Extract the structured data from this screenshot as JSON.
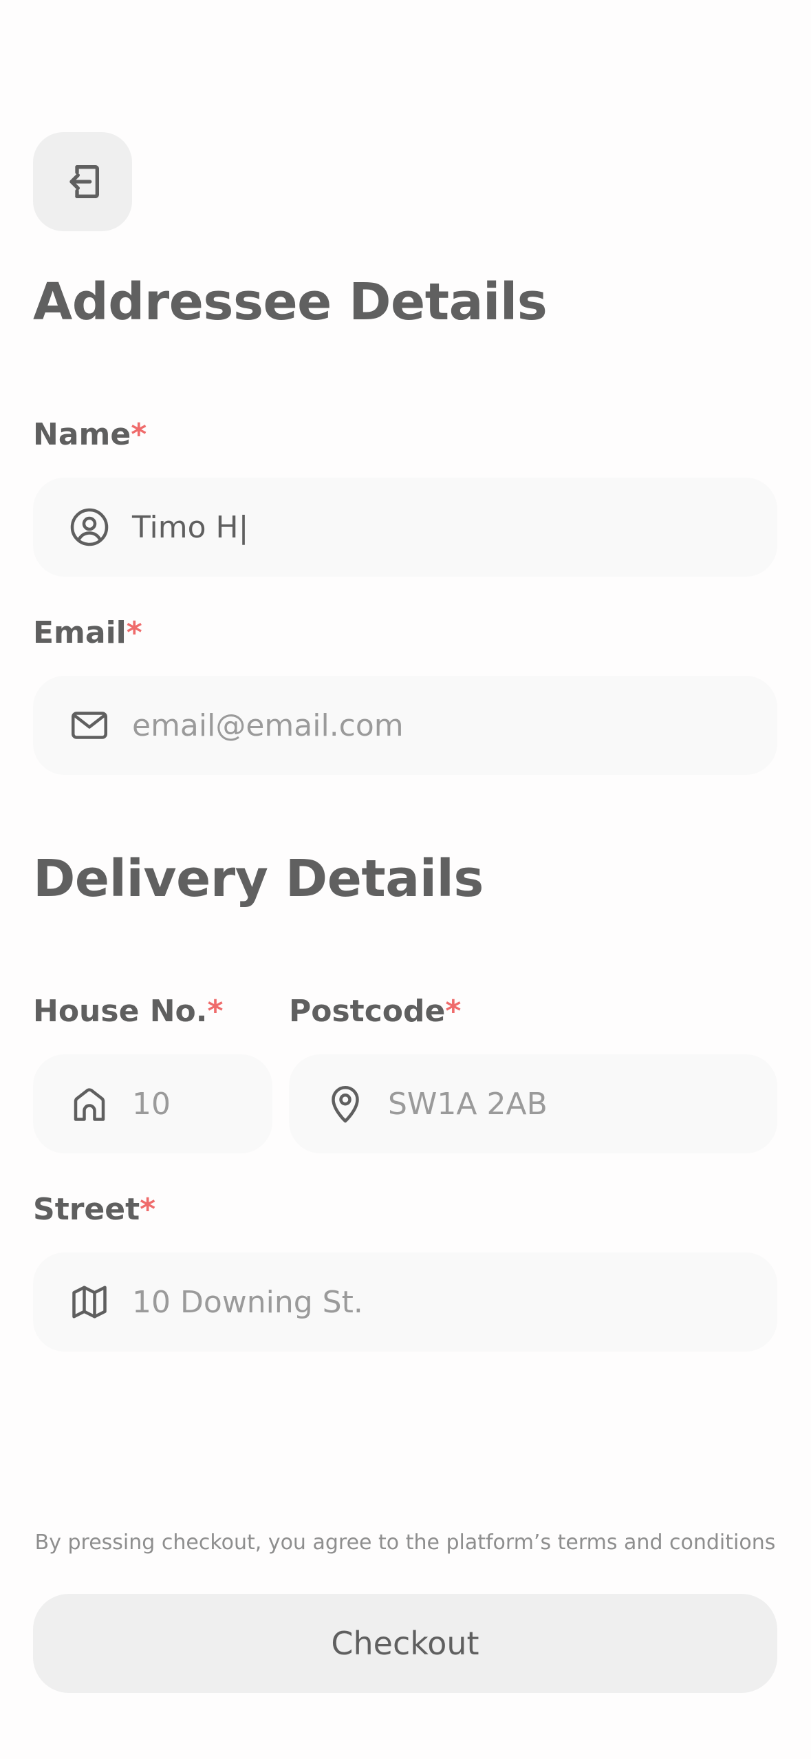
{
  "header": {
    "back_icon": "exit-arrow-left-icon"
  },
  "addressee": {
    "title": "Addressee Details",
    "name": {
      "label": "Name",
      "required_mark": "*",
      "value": "Timo H",
      "caret": "|",
      "icon": "user-circle-icon"
    },
    "email": {
      "label": "Email",
      "required_mark": "*",
      "placeholder": "email@email.com",
      "icon": "mail-icon"
    }
  },
  "delivery": {
    "title": "Delivery Details",
    "house_no": {
      "label": "House No.",
      "required_mark": "*",
      "placeholder": "10",
      "icon": "home-icon"
    },
    "postcode": {
      "label": "Postcode",
      "required_mark": "*",
      "placeholder": "SW1A 2AB",
      "icon": "map-pin-icon"
    },
    "street": {
      "label": "Street",
      "required_mark": "*",
      "placeholder": "10 Downing St.",
      "icon": "map-icon"
    }
  },
  "footer": {
    "terms": "By pressing checkout, you agree to the platform’s terms and conditions",
    "checkout_label": "Checkout"
  },
  "colors": {
    "background": "#fefdfd",
    "text": "#5f5f5f",
    "placeholder": "#9a9a9a",
    "required": "#ef6b6b",
    "field_bg": "#f9f9f9",
    "button_bg": "#efefef"
  }
}
